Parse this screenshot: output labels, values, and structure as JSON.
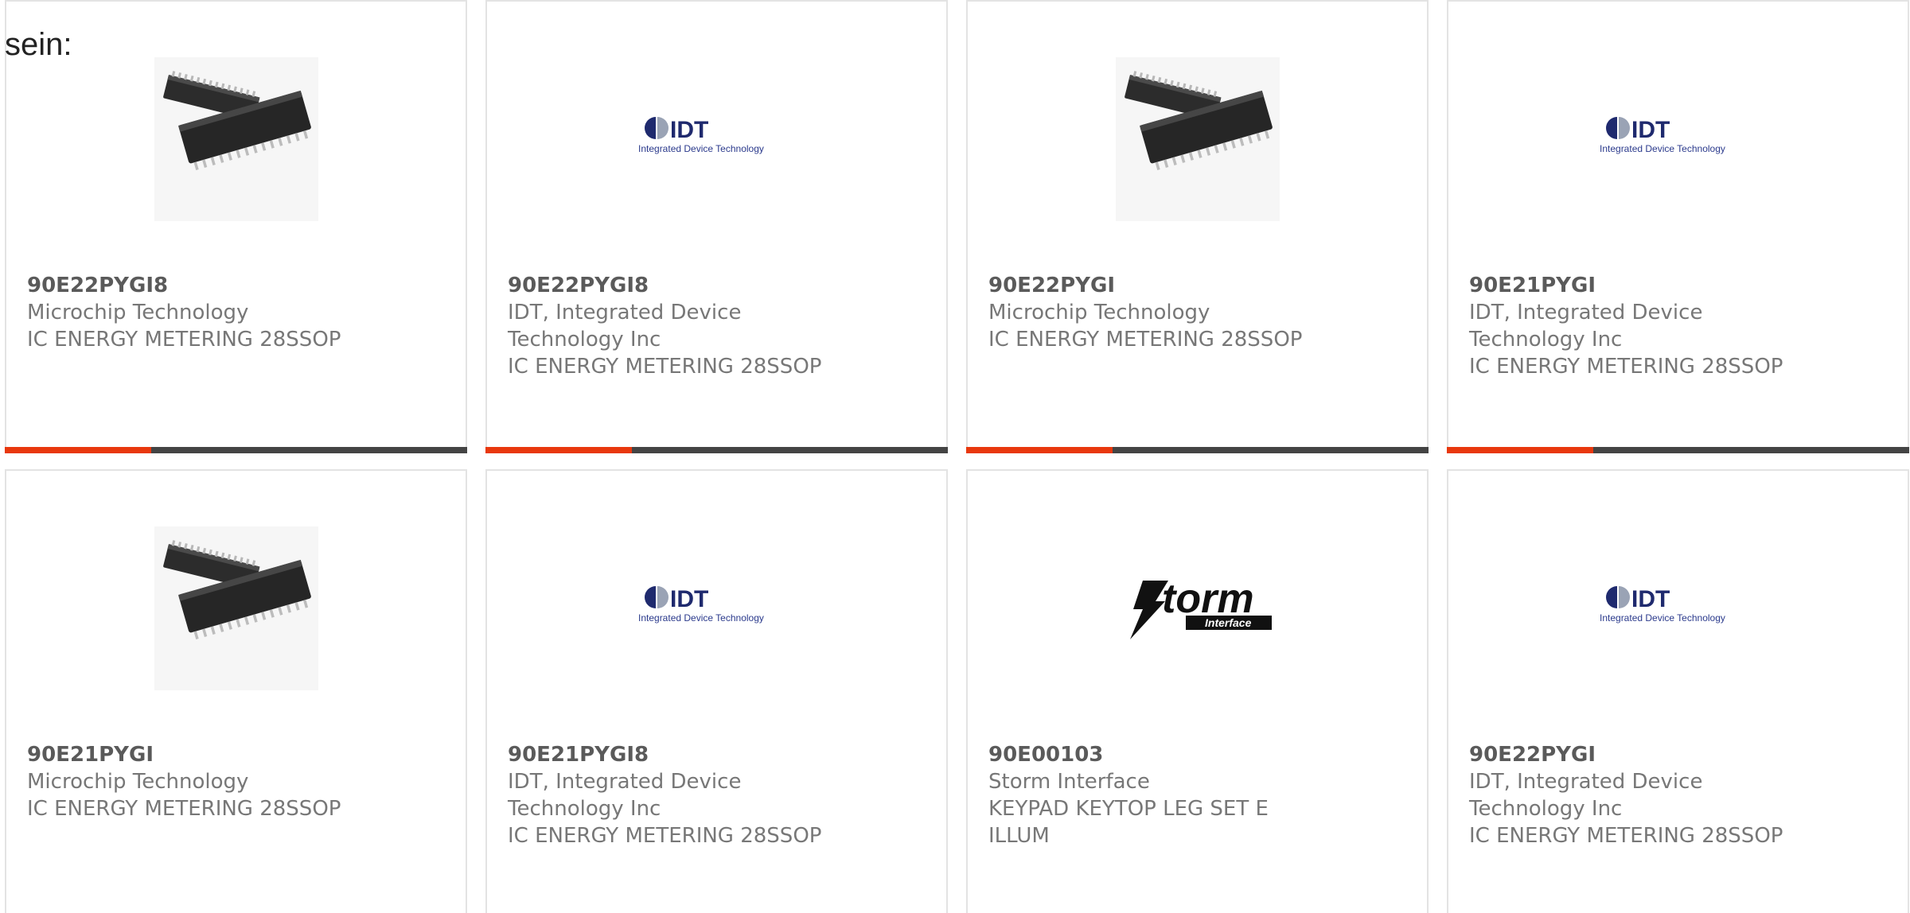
{
  "intro_text": "sein:",
  "colors": {
    "accent": "#e8380d",
    "bar": "#444444",
    "border": "#e3e3e3",
    "idt_blue": "#2b3a8c"
  },
  "cards": [
    {
      "part": "90E22PYGI8",
      "manufacturer": "Microchip Technology",
      "description": "IC ENERGY METERING 28SSOP",
      "image": "ssop-chip-image",
      "highlighted": true
    },
    {
      "part": "90E22PYGI8",
      "manufacturer": "IDT, Integrated Device Technology Inc",
      "description": "IC ENERGY METERING 28SSOP",
      "image": "idt-logo",
      "highlighted": true
    },
    {
      "part": "90E22PYGI",
      "manufacturer": "Microchip Technology",
      "description": "IC ENERGY METERING 28SSOP",
      "image": "ssop-chip-image",
      "highlighted": true
    },
    {
      "part": "90E21PYGI",
      "manufacturer": "IDT, Integrated Device Technology Inc",
      "description": "IC ENERGY METERING 28SSOP",
      "image": "idt-logo",
      "highlighted": true
    },
    {
      "part": "90E21PYGI",
      "manufacturer": "Microchip Technology",
      "description": "IC ENERGY METERING 28SSOP",
      "image": "ssop-chip-image"
    },
    {
      "part": "90E21PYGI8",
      "manufacturer": "IDT, Integrated Device Technology Inc",
      "description": "IC ENERGY METERING 28SSOP",
      "image": "idt-logo"
    },
    {
      "part": "90E00103",
      "manufacturer": "Storm Interface",
      "description": "KEYPAD KEYTOP LEG SET E ILLUM",
      "image": "storm-interface-logo"
    },
    {
      "part": "90E22PYGI",
      "manufacturer": "IDT, Integrated Device Technology Inc",
      "description": "IC ENERGY METERING 28SSOP",
      "image": "idt-logo"
    }
  ],
  "logos": {
    "idt_wordmark": "IDT",
    "idt_tagline": "Integrated Device Technology",
    "storm_wordmark": "torm",
    "storm_tagline": "Interface"
  }
}
